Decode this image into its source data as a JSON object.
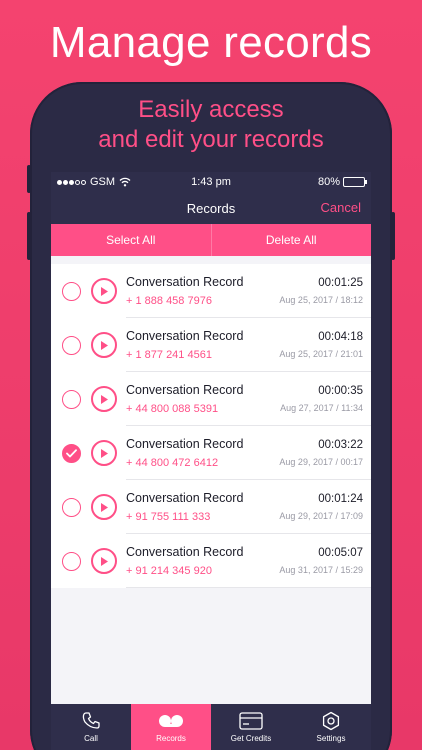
{
  "headline": "Manage records",
  "subtitle": {
    "line1": "Easily access",
    "line2": "and edit your records"
  },
  "status": {
    "carrier": "GSM",
    "time": "1:43 pm",
    "battery": "80%",
    "battery_level": 0.8
  },
  "nav": {
    "title": "Records",
    "cancel": "Cancel"
  },
  "actions": {
    "select_all": "Select All",
    "delete_all": "Delete All"
  },
  "records": [
    {
      "name": "Conversation Record",
      "phone": "+ 1 888 458 7976",
      "duration": "00:01:25",
      "date": "Aug 25, 2017 / 18:12",
      "selected": false
    },
    {
      "name": "Conversation Record",
      "phone": "+ 1 877 241 4561",
      "duration": "00:04:18",
      "date": "Aug 25, 2017 / 21:01",
      "selected": false
    },
    {
      "name": "Conversation Record",
      "phone": "+ 44 800 088 5391",
      "duration": "00:00:35",
      "date": "Aug 27, 2017 / 11:34",
      "selected": false
    },
    {
      "name": "Conversation Record",
      "phone": "+ 44 800 472 6412",
      "duration": "00:03:22",
      "date": "Aug 29, 2017 / 00:17",
      "selected": true
    },
    {
      "name": "Conversation Record",
      "phone": "+ 91 755 111 333",
      "duration": "00:01:24",
      "date": "Aug 29, 2017 / 17:09",
      "selected": false
    },
    {
      "name": "Conversation Record",
      "phone": "+ 91 214 345 920",
      "duration": "00:05:07",
      "date": "Aug 31, 2017 / 15:29",
      "selected": false
    }
  ],
  "tabs": [
    {
      "label": "Call",
      "icon": "phone-icon",
      "active": false
    },
    {
      "label": "Records",
      "icon": "tape-icon",
      "active": true
    },
    {
      "label": "Get Credits",
      "icon": "credit-card-icon",
      "active": false
    },
    {
      "label": "Settings",
      "icon": "gear-icon",
      "active": false
    }
  ],
  "colors": {
    "accent": "#ff4f87",
    "dark": "#2f2e4b",
    "background": "#f4436f"
  }
}
